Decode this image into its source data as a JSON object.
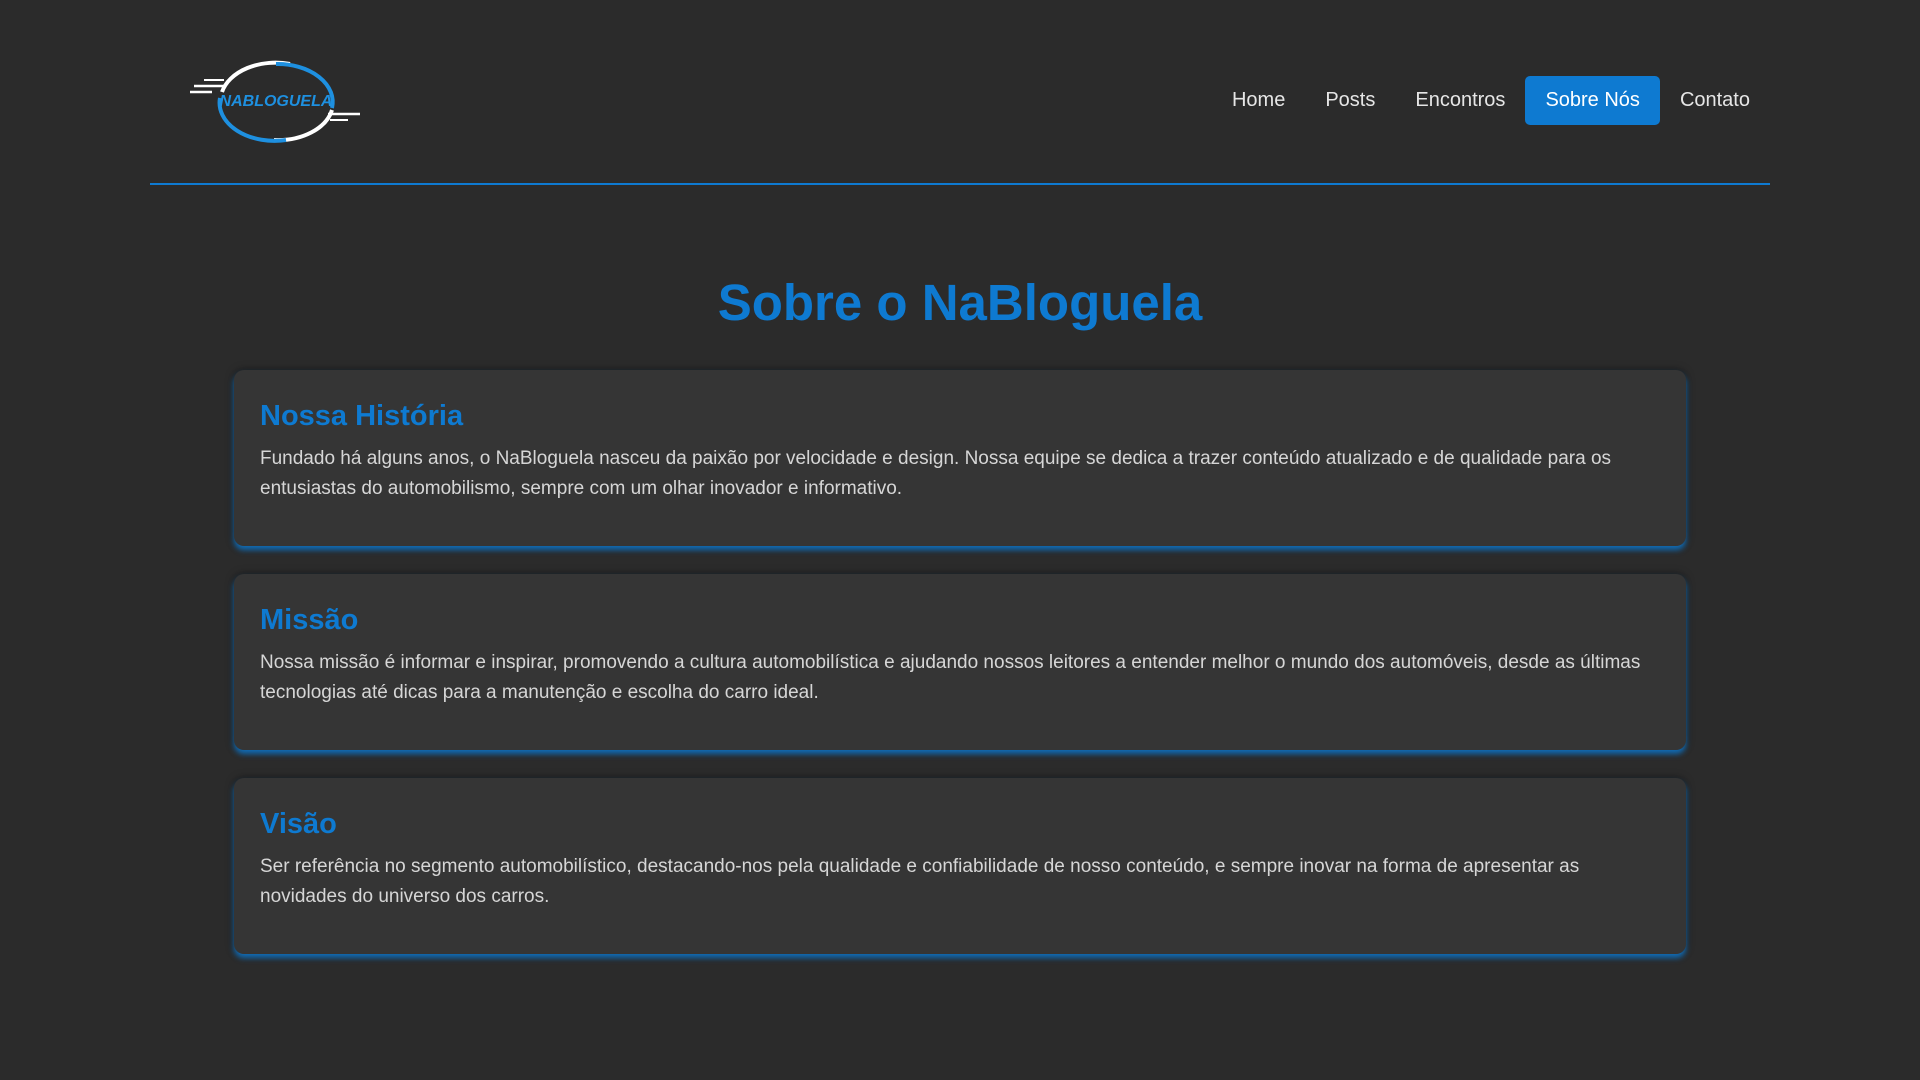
{
  "logo": {
    "text": "NABLOGUELA"
  },
  "nav": {
    "items": [
      {
        "label": "Home",
        "active": false
      },
      {
        "label": "Posts",
        "active": false
      },
      {
        "label": "Encontros",
        "active": false
      },
      {
        "label": "Sobre Nós",
        "active": true
      },
      {
        "label": "Contato",
        "active": false
      }
    ]
  },
  "main": {
    "title": "Sobre o NaBloguela",
    "sections": [
      {
        "heading": "Nossa História",
        "text": "Fundado há alguns anos, o NaBloguela nasceu da paixão por velocidade e design. Nossa equipe se dedica a trazer conteúdo atualizado e de qualidade para os entusiastas do automobilismo, sempre com um olhar inovador e informativo."
      },
      {
        "heading": "Missão",
        "text": "Nossa missão é informar e inspirar, promovendo a cultura automobilística e ajudando nossos leitores a entender melhor o mundo dos automóveis, desde as últimas tecnologias até dicas para a manutenção e escolha do carro ideal."
      },
      {
        "heading": "Visão",
        "text": "Ser referência no segmento automobilístico, destacando-nos pela qualidade e confiabilidade de nosso conteúdo, e sempre inovar na forma de apresentar as novidades do universo dos carros."
      }
    ]
  },
  "colors": {
    "accent": "#0e7ad1",
    "background": "#2b2b2b",
    "card": "#353535"
  }
}
